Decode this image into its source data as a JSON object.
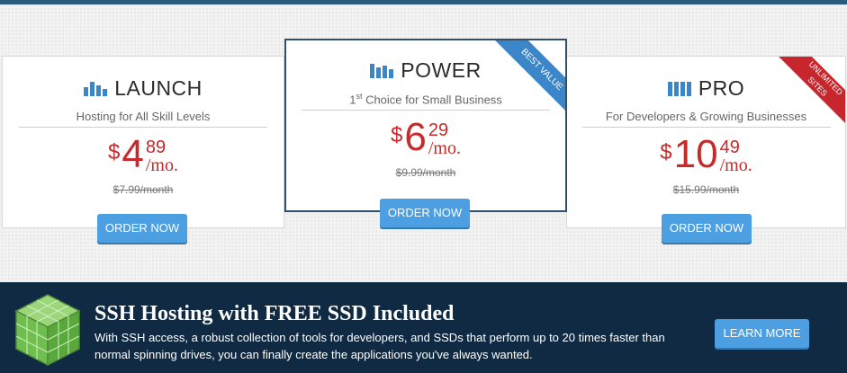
{
  "plans": [
    {
      "name": "LAUNCH",
      "subtitle": "Hosting for All Skill Levels",
      "currency": "$",
      "price_whole": "4",
      "price_cents": "89",
      "per": "/mo.",
      "old_price": "$7.99/month",
      "button": "ORDER NOW"
    },
    {
      "name": "POWER",
      "subtitle_prefix": "1",
      "subtitle_sup": "st",
      "subtitle_rest": " Choice for Small Business",
      "currency": "$",
      "price_whole": "6",
      "price_cents": "29",
      "per": "/mo.",
      "old_price": "$9.99/month",
      "button": "ORDER NOW",
      "ribbon": "BEST VALUE"
    },
    {
      "name": "PRO",
      "subtitle": "For Developers & Growing Businesses",
      "currency": "$",
      "price_whole": "10",
      "price_cents": "49",
      "per": "/mo.",
      "old_price": "$15.99/month",
      "button": "ORDER NOW",
      "ribbon_line1": "UNLIMITED",
      "ribbon_line2": "SITES"
    }
  ],
  "banner": {
    "title": "SSH Hosting with FREE SSD Included",
    "text": "With SSH access, a robust collection of tools for developers, and SSDs that perform up to 20 times faster than normal spinning drives, you can finally create the applications you've always wanted.",
    "button": "LEARN MORE",
    "icon": "cube-icon"
  },
  "colors": {
    "accent_blue": "#4c9fe0",
    "price_red": "#c62a2a",
    "banner_bg": "#0f2a42",
    "ribbon_red": "#c8262d"
  }
}
